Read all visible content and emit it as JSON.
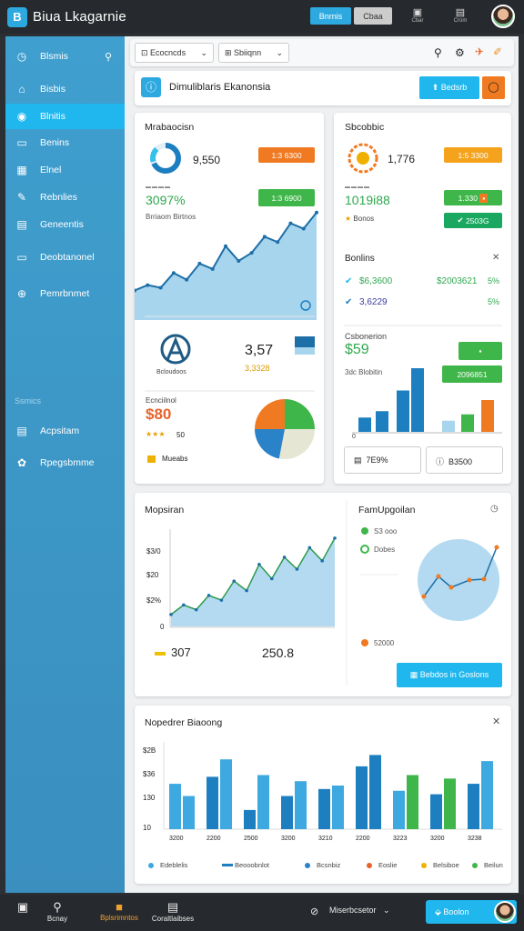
{
  "app": {
    "title": "Biua Lkagarnie",
    "logo_letter": "B"
  },
  "topbar": {
    "btn1": "Bnrnis",
    "btn2": "Cbaa",
    "icon1_label": "Cbar",
    "icon2_label": "Crom"
  },
  "sidebar": {
    "items": [
      {
        "label": "Blsmis",
        "icon": "clock-icon"
      },
      {
        "label": "Bisbis",
        "icon": "home-icon"
      },
      {
        "label": "Blnitis",
        "icon": "layers-icon"
      },
      {
        "label": "Benins",
        "icon": "folder-icon"
      },
      {
        "label": "Elnel",
        "icon": "table-icon"
      },
      {
        "label": "Rebnlies",
        "icon": "tool-icon"
      },
      {
        "label": "Geneentis",
        "icon": "grid-icon"
      },
      {
        "label": "Deobtanonel",
        "icon": "monitor-icon"
      },
      {
        "label": "Pemrbnmet",
        "icon": "plus-circle-icon"
      },
      {
        "label": "Acpsitam",
        "icon": "doc-icon"
      },
      {
        "label": "Rpegsbmme",
        "icon": "gear-icon"
      }
    ],
    "section_label": "Ssmics"
  },
  "toolbar": {
    "filter1": "Ecocncds",
    "filter2": "Sbiiqnn"
  },
  "banner": {
    "text": "Dimuliblaris Ekanonsia",
    "button": "Bedsrb"
  },
  "card1": {
    "title": "Mrabaocisn",
    "donut_value": "9,550",
    "pill1": "1:3 6300",
    "metric_value": "3097%",
    "metric_label": "Brriaom Birtnos",
    "pill2": "1:3 6900",
    "logo_value": "3,57",
    "logo_sub": "3,3328",
    "logo_caption": "Bcloudoos",
    "price_label": "Ecnciilnol",
    "price": "$80",
    "stars_label": "50",
    "footer_label": "Mueabs"
  },
  "card2": {
    "title": "Sbcobbic",
    "donut_value": "1,776",
    "pill1": "1:5 3300",
    "metric_value": "1019i88",
    "metric_label": "Bonos",
    "pill2a": "1.330",
    "pill2b": "2503G",
    "section": "Bonlins",
    "row1a": "$6,3600",
    "row1b": "$2003621",
    "row1c": "5%",
    "row2a": "3,6229",
    "row2c": "5%",
    "stat_label": "Csbonerion",
    "stat_value": "$59",
    "stat_sub": "3dc Blobitin",
    "stat_pill": "2096851",
    "footer1": "7E9%",
    "footer2": "B3500"
  },
  "card3": {
    "title": "Mopsiran",
    "yticks": [
      "$3/0",
      "$20",
      "$2%",
      "0"
    ],
    "value1": "307",
    "value2": "250.8",
    "right_title": "FamUpgoilan",
    "legend1": "S3 ooo",
    "legend2": "Dobes",
    "legend3": "52000",
    "button": "Bebdos in Goslons"
  },
  "card4": {
    "title": "Nopedrer Biaoong",
    "yticks": [
      "$2B",
      "$36",
      "130",
      "10"
    ],
    "xticks": [
      "3200",
      "2200",
      "2500",
      "3200",
      "3210",
      "2200",
      "3223",
      "3200",
      "3238"
    ],
    "legend": [
      "Edeblelis",
      "Beooobnlot",
      "Bcsnbiz",
      "Eoslie",
      "Belsiboe",
      "Beilun"
    ]
  },
  "bottombar": {
    "item1": "Bcnay",
    "item2": "Bplsrimntos",
    "item3": "Coraltlaibses",
    "dropdown": "Miserbcsetor",
    "button": "Boolon"
  },
  "chart_data": [
    {
      "type": "line",
      "title": "Mrabaocisn",
      "series": [
        {
          "values": [
            22,
            26,
            24,
            35,
            30,
            42,
            38,
            55,
            44,
            50,
            62,
            58,
            72,
            68,
            80
          ]
        }
      ]
    },
    {
      "type": "bar",
      "title": "Csbonerion",
      "values": [
        18,
        26,
        52,
        80,
        14,
        22,
        40
      ]
    },
    {
      "type": "line",
      "title": "Mopsiran",
      "series": [
        {
          "values": [
            10,
            18,
            14,
            26,
            22,
            38,
            30,
            52,
            40,
            58,
            48,
            66,
            55,
            74
          ]
        }
      ]
    },
    {
      "type": "bar",
      "title": "Nopedrer Biaoong",
      "categories": [
        "3200",
        "2200",
        "2500",
        "3200",
        "3210",
        "2200",
        "3223",
        "3200",
        "3238"
      ],
      "series": [
        {
          "values": [
            52,
            38
          ]
        },
        {
          "values": [
            60,
            80
          ]
        },
        {
          "values": [
            22,
            62
          ]
        },
        {
          "values": [
            38,
            55
          ]
        },
        {
          "values": [
            46,
            50
          ]
        },
        {
          "values": [
            72,
            85
          ]
        },
        {
          "values": [
            44,
            62
          ]
        },
        {
          "values": [
            40,
            58
          ]
        },
        {
          "values": [
            52,
            78
          ]
        }
      ]
    }
  ],
  "colors": {
    "accent": "#2ea9e0",
    "sidebar": "#3f9fce",
    "green": "#3fb64a",
    "orange": "#f07a21",
    "chart_fill": "#a7d5ee",
    "chart_line": "#1d6fa8"
  }
}
